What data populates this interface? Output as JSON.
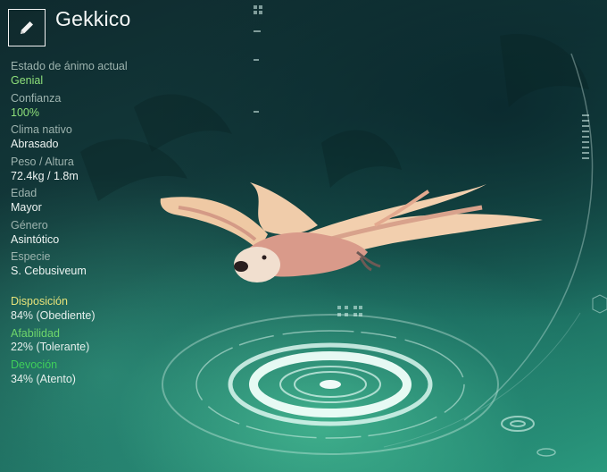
{
  "creature": {
    "name": "Gekkico"
  },
  "stats": [
    {
      "label": "Estado de ánimo actual",
      "value": "Genial",
      "highlight": true
    },
    {
      "label": "Confianza",
      "value": "100%",
      "highlight": true
    },
    {
      "label": "Clima nativo",
      "value": "Abrasado",
      "highlight": false
    },
    {
      "label": "Peso / Altura",
      "value": "72.4kg / 1.8m",
      "highlight": false
    },
    {
      "label": "Edad",
      "value": "Mayor",
      "highlight": false
    },
    {
      "label": "Género",
      "value": "Asintótico",
      "highlight": false
    },
    {
      "label": "Especie",
      "value": "S. Cebusiveum",
      "highlight": false
    }
  ],
  "traits": [
    {
      "label": "Disposición",
      "value": "84% (Obediente)",
      "color": "#e6e27a"
    },
    {
      "label": "Afabilidad",
      "value": "22% (Tolerante)",
      "color": "#6fd66b"
    },
    {
      "label": "Devoción",
      "value": "34% (Atento)",
      "color": "#3fcf5a"
    }
  ],
  "colors": {
    "highlight_green": "#8ee07a",
    "hologram": "#dff7f0"
  },
  "icons": {
    "edit": "pencil-icon"
  }
}
